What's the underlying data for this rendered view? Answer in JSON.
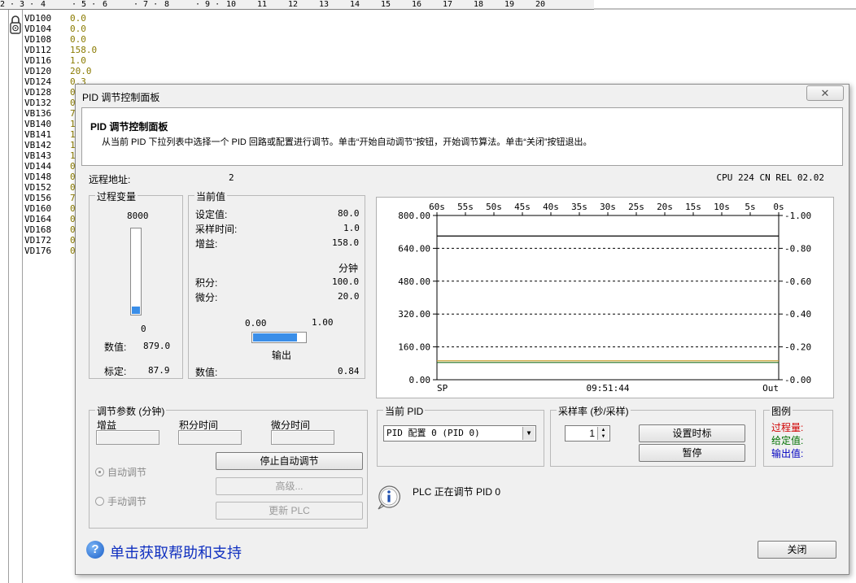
{
  "ruler": [
    "2",
    "· 3 ·",
    "4",
    "· 5 ·",
    "6",
    "· 7 ·",
    "8",
    "· 9 ·",
    "10",
    "11",
    "12",
    "13",
    "14",
    "15",
    "16",
    "17",
    "18",
    "19",
    "20"
  ],
  "status_chart": {
    "rows": [
      {
        "name": "VD100",
        "value": "0.0"
      },
      {
        "name": "VD104",
        "value": "0.0"
      },
      {
        "name": "VD108",
        "value": "0.0"
      },
      {
        "name": "VD112",
        "value": "158.0"
      },
      {
        "name": "VD116",
        "value": "1.0"
      },
      {
        "name": "VD120",
        "value": "20.0"
      },
      {
        "name": "VD124",
        "value": "0.3"
      },
      {
        "name": "VD128",
        "value": "0"
      },
      {
        "name": "VD132",
        "value": "0"
      },
      {
        "name": "VB136",
        "value": "7"
      },
      {
        "name": "VB140",
        "value": "1"
      },
      {
        "name": "VB141",
        "value": "1"
      },
      {
        "name": "VB142",
        "value": "1"
      },
      {
        "name": "VB143",
        "value": "1"
      },
      {
        "name": "VD144",
        "value": "0"
      },
      {
        "name": "VD148",
        "value": "0"
      },
      {
        "name": "VD152",
        "value": "0"
      },
      {
        "name": "VD156",
        "value": "7"
      },
      {
        "name": "VD160",
        "value": "0"
      },
      {
        "name": "VD164",
        "value": "0"
      },
      {
        "name": "VD168",
        "value": "0"
      },
      {
        "name": "VD172",
        "value": "0"
      },
      {
        "name": "VD176",
        "value": "0"
      }
    ]
  },
  "dialog": {
    "title": "PID 调节控制面板",
    "close_glyph": "✕",
    "header_title": "PID 调节控制面板",
    "header_desc": "从当前 PID 下拉列表中选择一个 PID 回路或配置进行调节。单击“开始自动调节”按钮，开始调节算法。单击“关闭”按钮退出。",
    "remote_label": "远程地址:",
    "remote_value": "2",
    "cpu_info": "CPU 224 CN REL 02.02"
  },
  "process_var": {
    "legend": "过程变量",
    "top": "8000",
    "bottom": "0",
    "fill_fraction": 0.09,
    "value_label": "数值:",
    "value": "879.0",
    "scale_label": "标定:",
    "scale": "87.9"
  },
  "current": {
    "legend": "当前值",
    "setpoint_label": "设定值:",
    "setpoint": "80.0",
    "sample_label": "采样时间:",
    "sample": "1.0",
    "gain_label": "增益:",
    "gain": "158.0",
    "minutes": "分钟",
    "integral_label": "积分:",
    "integral": "100.0",
    "derivative_label": "微分:",
    "derivative": "20.0",
    "out_min": "0.00",
    "out_max": "1.00",
    "out_fraction": 0.84,
    "output_label": "输出",
    "value_label": "数值:",
    "value": "0.84"
  },
  "chart_data": {
    "type": "line",
    "top_ticks": [
      "60s",
      "55s",
      "50s",
      "45s",
      "40s",
      "35s",
      "30s",
      "25s",
      "20s",
      "15s",
      "10s",
      "5s",
      "0s"
    ],
    "left_ticks": [
      "800.00",
      "640.00",
      "480.00",
      "320.00",
      "160.00",
      "0.00"
    ],
    "right_ticks": [
      "1.00",
      "0.80",
      "0.60",
      "0.40",
      "0.20",
      "0.00"
    ],
    "ylim_left": [
      0,
      800
    ],
    "ylim_right": [
      0,
      1
    ],
    "x_start": "SP",
    "x_mid": "09:51:44",
    "x_end": "Out",
    "series": [
      {
        "color": "#000000",
        "values": [
          700,
          700
        ]
      },
      {
        "color": "#c8a030",
        "values": [
          92,
          92
        ]
      },
      {
        "color": "#207020",
        "values": [
          84,
          84
        ]
      }
    ],
    "grid": true
  },
  "tuning": {
    "legend": "调节参数 (分钟)",
    "gain_label": "增益",
    "integral_label": "积分时间",
    "derivative_label": "微分时间",
    "auto_label": "自动调节",
    "manual_label": "手动调节",
    "stop_button": "停止自动调节",
    "advanced_button": "高级...",
    "update_button": "更新 PLC"
  },
  "pid_select": {
    "legend": "当前 PID",
    "selected": "PID 配置 0 (PID 0)"
  },
  "sampling": {
    "legend": "采样率 (秒/采样)",
    "value": "1",
    "set_button": "设置时标",
    "pause_button": "暂停"
  },
  "legend_box": {
    "legend": "图例",
    "pv": "过程量:",
    "sp": "给定值:",
    "out": "输出值:",
    "colors": {
      "pv": "#d00000",
      "sp": "#007000",
      "out": "#0000c0"
    }
  },
  "status_message": "PLC 正在调节 PID 0",
  "help_link": "单击获取帮助和支持",
  "close_button": "关闭"
}
